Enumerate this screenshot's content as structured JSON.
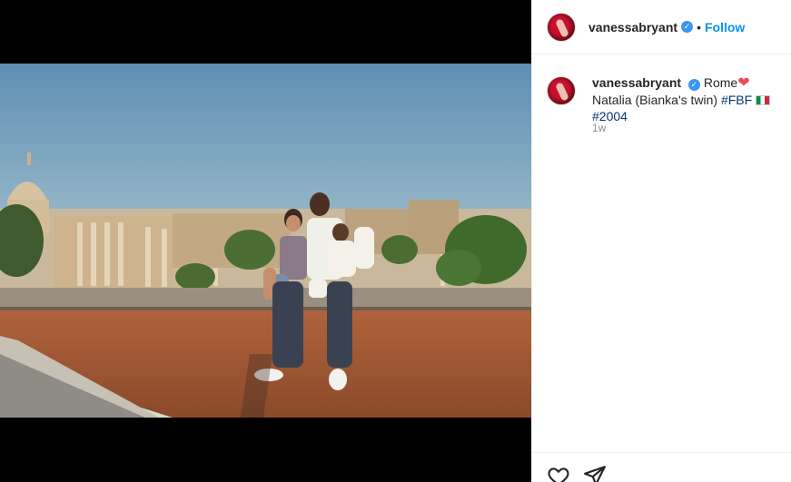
{
  "post": {
    "username": "vanessabryant",
    "follow_label": "Follow",
    "separator": "•",
    "caption": {
      "username": "vanessabryant",
      "text_before_heart": "Rome",
      "heart_emoji": "❤",
      "text_after_heart": "Natalia (Bianka's twin)",
      "hashtag_1": "#FBF",
      "hashtag_2": "#2004"
    },
    "timestamp": "1w"
  },
  "icons": {
    "like": "heart-outline-icon",
    "share": "paper-plane-icon",
    "verified": "verified-badge-icon"
  },
  "colors": {
    "follow_blue": "#0095f6",
    "verified_blue": "#3897f0",
    "hashtag_blue": "#00376b",
    "muted_text": "#8e8e8e"
  }
}
